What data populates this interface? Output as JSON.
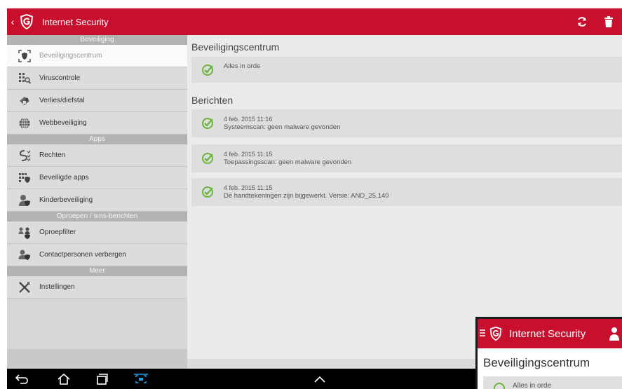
{
  "app": {
    "title": "Internet Security",
    "back_glyph": "‹"
  },
  "colors": {
    "brand_red": "#c8102e",
    "check_green": "#6db33f"
  },
  "sidebar": {
    "sections": [
      {
        "header": "Beveiliging",
        "items": [
          {
            "label": "Beveiligingscentrum",
            "icon": "shield-target-icon",
            "active": true
          },
          {
            "label": "Viruscontrole",
            "icon": "virus-scan-icon"
          },
          {
            "label": "Verlies/diefstal",
            "icon": "theft-icon"
          },
          {
            "label": "Webbeveiliging",
            "icon": "globe-icon"
          }
        ]
      },
      {
        "header": "Apps",
        "items": [
          {
            "label": "Rechten",
            "icon": "permissions-icon"
          },
          {
            "label": "Beveiligde apps",
            "icon": "secured-apps-icon"
          },
          {
            "label": "Kinderbeveiliging",
            "icon": "child-protection-icon"
          }
        ]
      },
      {
        "header": "Oproepen / sms-berichten",
        "items": [
          {
            "label": "Oproepfilter",
            "icon": "call-filter-icon"
          },
          {
            "label": "Contactpersonen verbergen",
            "icon": "hide-contacts-icon"
          }
        ]
      },
      {
        "header": "Meer",
        "items": [
          {
            "label": "Instellingen",
            "icon": "settings-tools-icon"
          }
        ]
      }
    ]
  },
  "main": {
    "status_title": "Beveiligingscentrum",
    "status_text": "Alles in orde",
    "messages_title": "Berichten",
    "messages": [
      {
        "date": "4 feb. 2015 11:16",
        "text": "Systeemscan: geen malware gevonden"
      },
      {
        "date": "4 feb. 2015 11:15",
        "text": "Toepassingsscan: geen malware gevonden"
      },
      {
        "date": "4 feb. 2015 11:15",
        "text": "De handtekeningen zijn bijgewerkt. Versie: AND_25.140"
      }
    ]
  },
  "overlay_phone": {
    "title": "Internet Security",
    "section_title": "Beveiligingscentrum",
    "status_text": "Alles in orde"
  }
}
